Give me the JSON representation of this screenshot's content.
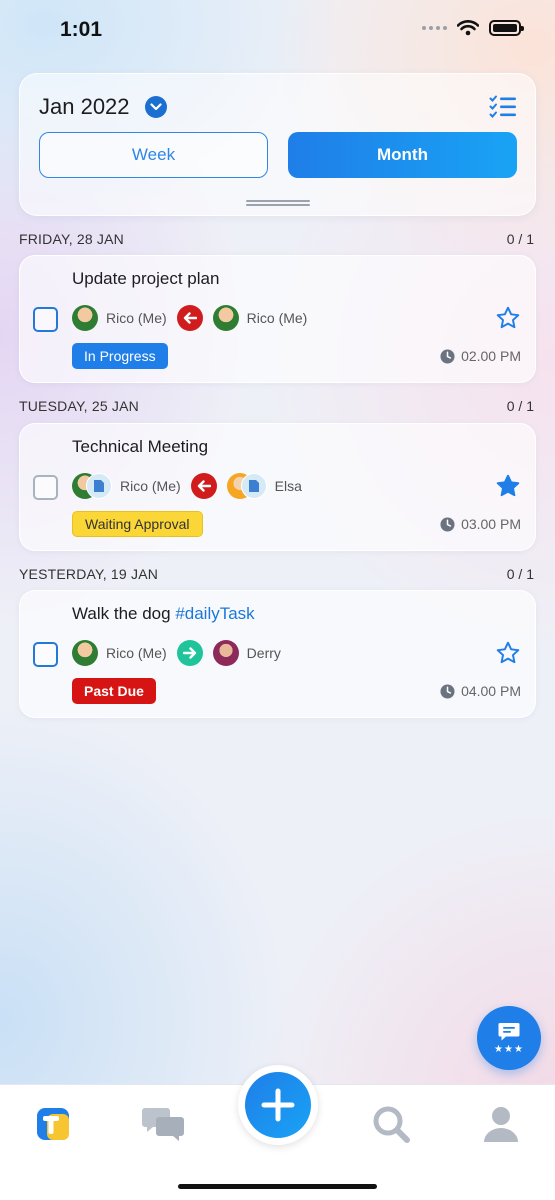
{
  "status_bar": {
    "time": "1:01"
  },
  "header": {
    "month_label": "Jan 2022",
    "segments": {
      "week": "Week",
      "month": "Month",
      "selected": "Month"
    }
  },
  "sections": [
    {
      "date": "FRIDAY, 28 JAN",
      "count": "0 / 1",
      "task": {
        "title": "Update project plan",
        "hashtag": "",
        "from": "Rico (Me)",
        "to": "Rico (Me)",
        "direction": "left",
        "status": "In Progress",
        "time": "02.00 PM",
        "starred": false
      }
    },
    {
      "date": "TUESDAY, 25 JAN",
      "count": "0 / 1",
      "task": {
        "title": "Technical Meeting",
        "hashtag": "",
        "from": "Rico (Me)",
        "to": "Elsa",
        "direction": "left",
        "status": "Waiting Approval",
        "time": "03.00 PM",
        "starred": true
      }
    },
    {
      "date": "YESTERDAY, 19 JAN",
      "count": "0 / 1",
      "task": {
        "title": "Walk the dog ",
        "hashtag": "#dailyTask",
        "from": "Rico (Me)",
        "to": "Derry",
        "direction": "right",
        "status": "Past Due",
        "time": "04.00 PM",
        "starred": false
      }
    }
  ],
  "colors": {
    "accent": "#1f7ee8",
    "in_progress": "#1f7ee8",
    "waiting": "#fbd637",
    "past_due": "#d71414"
  },
  "icons": {
    "month_dropdown": "chevron-down-icon",
    "task_list": "checklist-icon",
    "clock": "clock-icon",
    "star": "star-icon",
    "review": "chat-review-icon",
    "nav": [
      "app-logo-icon",
      "chat-icon",
      "add-icon",
      "search-icon",
      "profile-icon"
    ]
  }
}
